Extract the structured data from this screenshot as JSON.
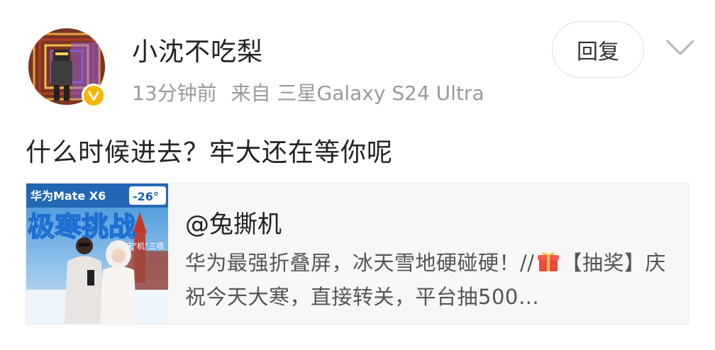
{
  "comment": {
    "username": "小沈不吃梨",
    "time": "13分钟前",
    "source": "来自 三星Galaxy S24 Ultra",
    "reply_label": "回复",
    "text": "什么时候进去？牢大还在等你呢"
  },
  "quoted": {
    "author": "@兔撕机",
    "text_part1": "华为最强折叠屏，冰天雪地硬碰硬！//",
    "text_part2": "【抽奖】庆祝今天大寒，直接转关，平台抽500…",
    "thumbnail": {
      "line1": "华为Mate X6",
      "temp": "-26°",
      "headline": "极寒挑战",
      "sub": "庆\"机\"三项"
    }
  },
  "icons": {
    "verified": "verified-badge-icon",
    "menu": "chevron-down-icon",
    "gift": "gift-emoji-icon"
  },
  "colors": {
    "accent_badge": "#f7b500",
    "meta_text": "#9a9a9a"
  }
}
